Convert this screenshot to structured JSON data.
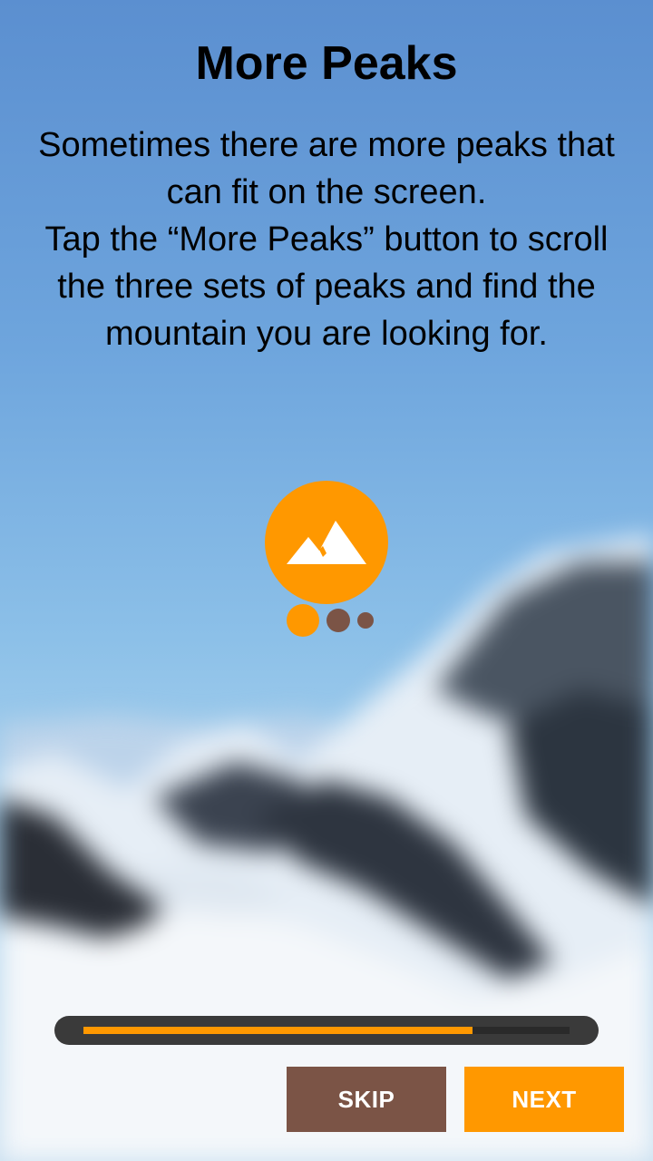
{
  "onboarding": {
    "title": "More Peaks",
    "description": "Sometimes there are more peaks that can fit on the screen.\nTap the “More Peaks” button to scroll the three sets of peaks and find the mountain you are looking for.",
    "icon": "mountain-icon",
    "page_indicator": {
      "total": 3,
      "current": 1
    },
    "progress": 0.8
  },
  "buttons": {
    "skip_label": "SKIP",
    "next_label": "NEXT"
  },
  "colors": {
    "accent": "#ff9800",
    "secondary": "#7b5446",
    "track": "#3a3a3a"
  }
}
